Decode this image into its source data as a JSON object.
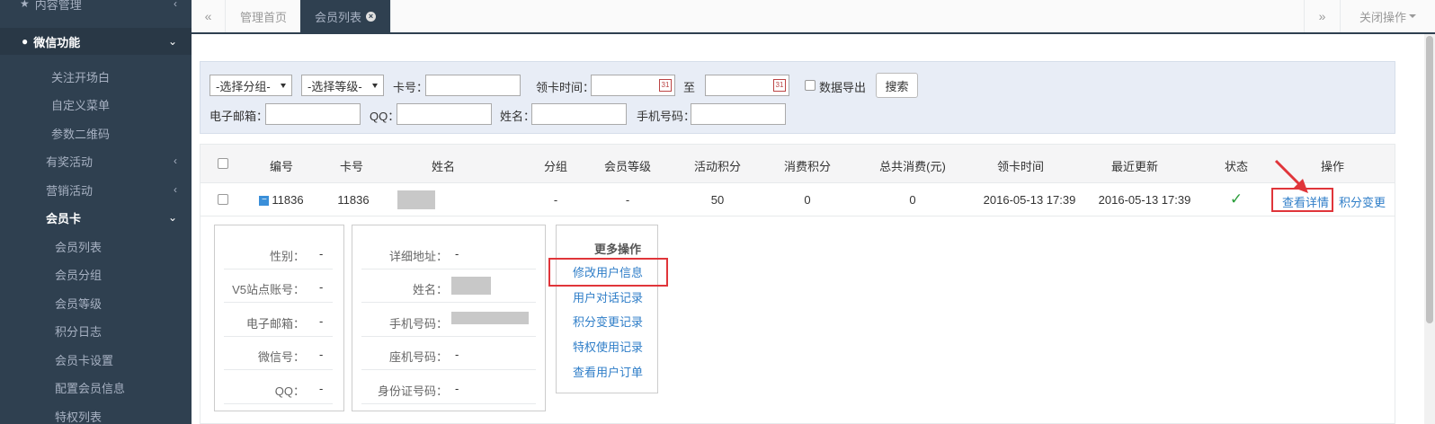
{
  "sidebar": {
    "content_mgmt": "内容管理",
    "wechat": "微信功能",
    "items": [
      "关注开场白",
      "自定义菜单",
      "参数二维码"
    ],
    "rewards": "有奖活动",
    "marketing": "营销活动",
    "membercard": "会员卡",
    "sub_items": [
      "会员列表",
      "会员分组",
      "会员等级",
      "积分日志",
      "会员卡设置",
      "配置会员信息",
      "特权列表"
    ]
  },
  "tabs": {
    "prev": "«",
    "home": "管理首页",
    "member_list": "会员列表",
    "next": "»",
    "close_ops": "关闭操作"
  },
  "search": {
    "group_select": "-选择分组-",
    "level_select": "-选择等级-",
    "card_label": "卡号：",
    "cardtime_label": "领卡时间：",
    "to_label": "至",
    "export_label": "数据导出",
    "search_btn": "搜索",
    "email_label": "电子邮箱：",
    "qq_label": "QQ：",
    "name_label": "姓名：",
    "phone_label": "手机号码："
  },
  "table": {
    "headers": [
      "编号",
      "卡号",
      "姓名",
      "分组",
      "会员等级",
      "活动积分",
      "消费积分",
      "总共消费(元)",
      "领卡时间",
      "最近更新",
      "状态",
      "操作"
    ],
    "row": {
      "id": "11836",
      "card": "11836",
      "group": "-",
      "level": "-",
      "activity_points": "50",
      "consume_points": "0",
      "total_spent": "0",
      "card_time": "2016-05-13 17:39",
      "updated": "2016-05-13 17:39",
      "status": "✓",
      "action_detail": "查看详情",
      "action_points": "积分变更"
    }
  },
  "detail_left": {
    "rows": [
      {
        "label": "性别：",
        "value": "-"
      },
      {
        "label": "V5站点账号：",
        "value": "-"
      },
      {
        "label": "电子邮箱：",
        "value": "-"
      },
      {
        "label": "微信号：",
        "value": "-"
      },
      {
        "label": "QQ：",
        "value": "-"
      }
    ]
  },
  "detail_mid": {
    "address_label": "详细地址：",
    "address_value": "-",
    "name_label": "姓名：",
    "phone_label": "手机号码：",
    "tel_label": "座机号码：",
    "tel_value": "-",
    "idcard_label": "身份证号码：",
    "idcard_value": "-"
  },
  "more_ops": {
    "title": "更多操作",
    "items": [
      "修改用户信息",
      "用户对话记录",
      "积分变更记录",
      "特权使用记录",
      "查看用户订单"
    ]
  },
  "colors": {
    "sidebar_bg": "#2f4050",
    "link": "#2f7ec8",
    "highlight": "#e0353a",
    "status_green": "#2a9d3a"
  }
}
